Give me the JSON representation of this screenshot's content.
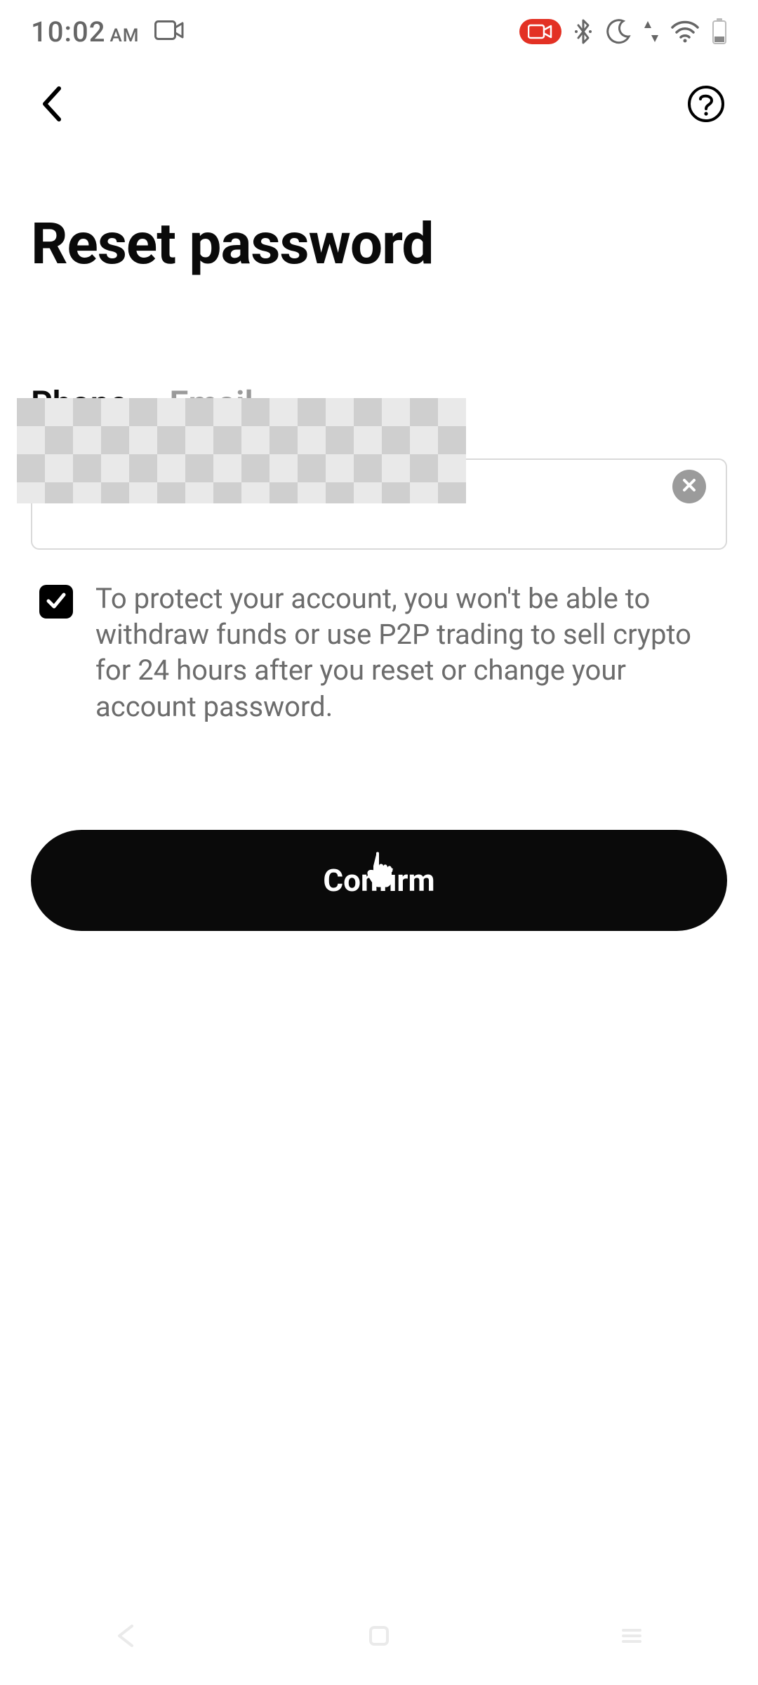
{
  "status": {
    "time": "10:02",
    "ampm": "AM"
  },
  "header": {},
  "page": {
    "title": "Reset password"
  },
  "tabs": {
    "items": [
      {
        "label": "Phone",
        "active": true
      },
      {
        "label": "Email",
        "active": false
      }
    ]
  },
  "input": {
    "value": ""
  },
  "disclaimer": {
    "checked": true,
    "text": "To protect your account, you won't be able to withdraw funds or use P2P trading to sell crypto for 24 hours after you reset or change your account password."
  },
  "actions": {
    "confirm_label": "Confirm"
  }
}
